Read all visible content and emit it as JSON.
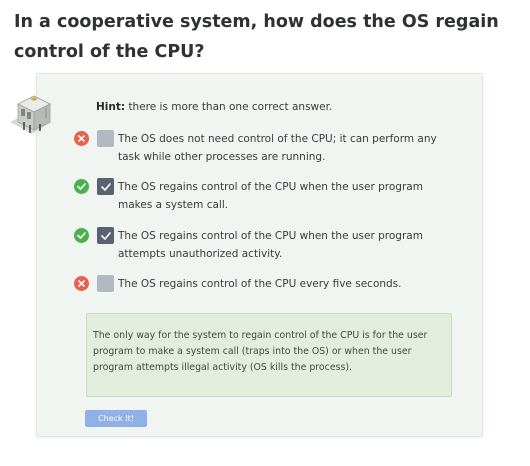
{
  "question": {
    "title": "In a cooperative system, how does the OS regain control of the CPU?"
  },
  "hint": {
    "label": "Hint:",
    "text": "there is more than one correct answer."
  },
  "options": [
    {
      "text": "The OS does not need control of the CPU; it can perform any task while other processes are running.",
      "checked": false,
      "status": "incorrect"
    },
    {
      "text": "The OS regains control of the CPU when the user program makes a system call.",
      "checked": true,
      "status": "correct"
    },
    {
      "text": "The OS regains control of the CPU when the user program attempts unauthorized activity.",
      "checked": true,
      "status": "correct"
    },
    {
      "text": "The OS regains control of the CPU every five seconds.",
      "checked": false,
      "status": "incorrect"
    }
  ],
  "explanation": {
    "text": "The only way for the system to regain control of the CPU is for the user program to make a system call (traps into the OS) or when the user program attempts illegal activity (OS kills the process)."
  },
  "check_button": {
    "label": "Check It!"
  },
  "colors": {
    "correct": "#4caf50",
    "incorrect": "#e8624f",
    "checkbox_checked": "#5a6170",
    "checkbox_unchecked": "#b4b8c0",
    "button": "#8fb1e6",
    "explanation_bg": "#e3edde"
  },
  "icons": {
    "correct": "check-circle-icon",
    "incorrect": "x-circle-icon",
    "checked": "checkmark-icon",
    "character": "robot-character-icon"
  }
}
